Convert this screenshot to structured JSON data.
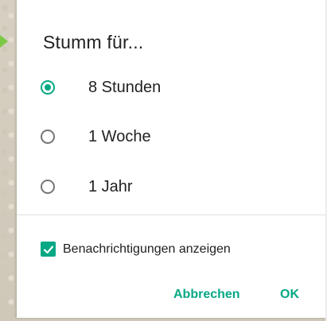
{
  "dialog": {
    "title": "Stumm für...",
    "options": [
      {
        "label": "8 Stunden",
        "selected": true
      },
      {
        "label": "1 Woche",
        "selected": false
      },
      {
        "label": "1 Jahr",
        "selected": false
      }
    ],
    "show_notifications": {
      "label": "Benachrichtigungen anzeigen",
      "checked": true
    },
    "buttons": {
      "cancel_label": "Abbrechen",
      "ok_label": "OK"
    }
  },
  "colors": {
    "accent": "#07a884",
    "text": "#212121",
    "radio_unchecked": "#757575"
  },
  "icons": {
    "radio_selected": "radio-selected-icon",
    "radio_unselected": "radio-unselected-icon",
    "checkbox_checked": "checkbox-checked-icon"
  }
}
